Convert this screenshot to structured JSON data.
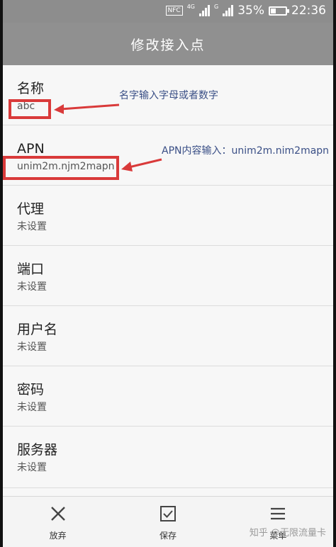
{
  "status_bar": {
    "nfc": "NFC",
    "net_type_1": "4G",
    "net_type_2": "G",
    "battery_percent": "35%",
    "time": "22:36"
  },
  "header": {
    "title": "修改接入点"
  },
  "fields": [
    {
      "label": "名称",
      "value": "abc"
    },
    {
      "label": "APN",
      "value": "unim2m.njm2mapn"
    },
    {
      "label": "代理",
      "value": "未设置"
    },
    {
      "label": "端口",
      "value": "未设置"
    },
    {
      "label": "用户名",
      "value": "未设置"
    },
    {
      "label": "密码",
      "value": "未设置"
    },
    {
      "label": "服务器",
      "value": "未设置"
    }
  ],
  "annotations": {
    "name_hint": "名字输入字母或者数字",
    "apn_hint": "APN内容输入：unim2m.nim2mapn"
  },
  "bottom_bar": {
    "discard_label": "放弃",
    "save_label": "保存",
    "menu_label": "菜单"
  },
  "watermark": "知乎 @无限流量卡",
  "colors": {
    "annotation_red": "#d93a3a",
    "annotation_text": "#3a4f86",
    "header_bg": "#909090",
    "status_bg": "#8d8d8d"
  }
}
